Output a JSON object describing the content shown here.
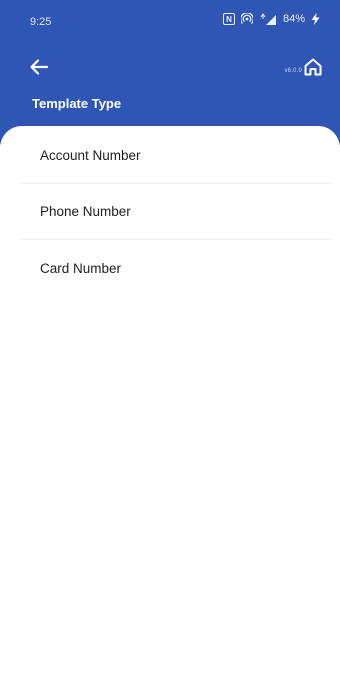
{
  "status_bar": {
    "time": "9:25",
    "battery": "84%",
    "icons": [
      "nfc-icon",
      "hotspot-icon",
      "signal-4g-icon",
      "charging-icon"
    ]
  },
  "header": {
    "title": "Template Type",
    "version": "v6.0.9",
    "back_icon": "arrow-left-icon",
    "home_icon": "home-icon",
    "background_color": "#2f56b4"
  },
  "template_types": [
    {
      "label": "Account Number"
    },
    {
      "label": "Phone Number"
    },
    {
      "label": "Card Number"
    }
  ]
}
